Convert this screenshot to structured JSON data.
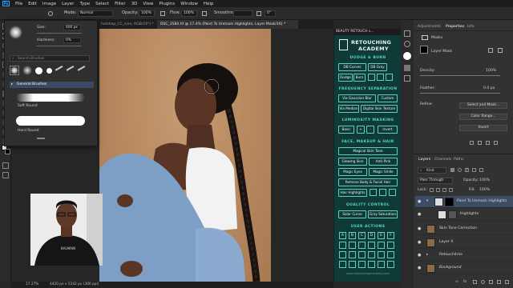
{
  "menu": {
    "app_logo": "Ps",
    "items": [
      "File",
      "Edit",
      "Image",
      "Layer",
      "Type",
      "Select",
      "Filter",
      "3D",
      "View",
      "Plugins",
      "Window",
      "Help"
    ]
  },
  "options": {
    "mode_label": "Mode:",
    "mode_value": "Normal",
    "opacity_label": "Opacity:",
    "opacity_value": "100%",
    "flow_label": "Flow:",
    "flow_value": "100%",
    "smoothing_label": "Smoothing:",
    "angle_value": "0°"
  },
  "brush_popup": {
    "size_label": "Size:",
    "size_value": "400 px",
    "hardness_label": "Hardness:",
    "hardness_value": "0%",
    "search_placeholder": "Search Brushes",
    "group_label": "General Brushes",
    "brush1": "Soft Round",
    "brush2": "Hard Round"
  },
  "doc_tabs": [
    {
      "label": "hotshop_CC_icon, RGB/16*) *"
    },
    {
      "label": "DSC_3584.tif @ 17.4% (Paint To Unmask Highlights, Layer Mask/16) *"
    }
  ],
  "status": {
    "zoom": "17.27%",
    "dims": "4420 px x 5342 px (300 ppi)"
  },
  "retouch": {
    "panel_title": "BEAUTY RETOUCH v...",
    "logo_line1": "RETOUCHING",
    "logo_line2": "ACADEMY",
    "dodge_burn_title": "DODGE & BURN",
    "db_curves": "DB Curves",
    "db_gray": "DB Gray",
    "dodge": "Dodge",
    "burn": "Burn",
    "fs_title": "FREQUENCY SEPARATION",
    "via_gaussian": "Via Gaussian Blur",
    "custom": "Custom",
    "via_median": "Via Median",
    "digital_skin": "Digital Skin Texture",
    "lum_title": "LUMINOSITY MASKING",
    "basic": "Basic",
    "plus": "+",
    "minus": "-",
    "invert": "Invert",
    "fmh_title": "FACE, MAKEUP & HAIR",
    "magical_skin": "Magical Skin Tone",
    "glowing_skin": "Glowing Skin",
    "anti_pink": "Anti-Pink",
    "magic_eyes": "Magic Eyes",
    "magic_smile": "Magic Smile",
    "remove_body": "Remove Body & Facial Hair",
    "hair_highlights": "Hair Highlights",
    "qc_title": "QUALITY CONTROL",
    "solar_curve": "Solar Curve",
    "gray_saturation": "Gray Saturation",
    "ua_title": "USER ACTIONS",
    "ua_row1": [
      "A",
      "B",
      "C",
      "D",
      "E",
      "F"
    ],
    "footer": "www.retouchingacademy.com"
  },
  "properties": {
    "tab_adjustments": "Adjustments",
    "tab_properties": "Properties",
    "tab_info": "Info",
    "masks_label": "Masks",
    "layer_mask_label": "Layer Mask",
    "density_label": "Density:",
    "density_value": "100%",
    "feather_label": "Feather:",
    "feather_value": "0.0 px",
    "refine_label": "Refine:",
    "select_mask_btn": "Select and Mask...",
    "color_range_btn": "Color Range...",
    "invert_btn": "Invert"
  },
  "layers_panel": {
    "tab_layers": "Layers",
    "tab_channels": "Channels",
    "tab_paths": "Paths",
    "kind_label": "Kind",
    "blend_value": "Pass Through",
    "opacity_label": "Opacity:",
    "opacity_value": "100%",
    "lock_label": "Lock:",
    "fill_label": "Fill:",
    "fill_value": "100%",
    "layers": [
      {
        "name": "Paint To Unmask Highlights",
        "selected": true
      },
      {
        "name": "Highlights",
        "selected": false
      },
      {
        "name": "Skin Tone Correction",
        "selected": false
      },
      {
        "name": "Layer 4",
        "selected": false
      },
      {
        "name": "Retouch4me",
        "selected": false
      },
      {
        "name": "Background",
        "selected": false
      }
    ]
  },
  "colors": {
    "accent": "#31a8ff",
    "retouch_bg": "#0f3a36",
    "retouch_teal": "#5fcfc2",
    "selected_layer": "#3e4d66"
  }
}
